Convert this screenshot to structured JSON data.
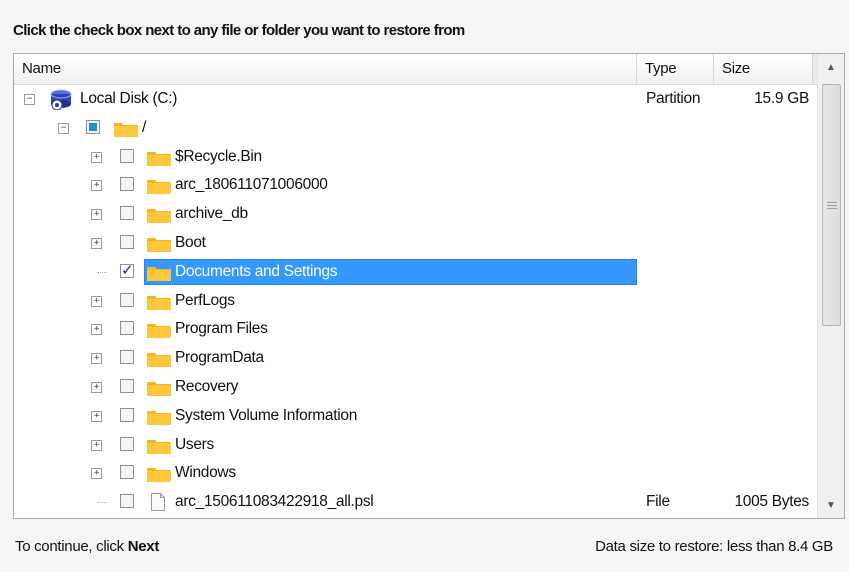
{
  "instruction": "Click the check box next to any file or folder you want to restore from",
  "columns": {
    "name": "Name",
    "type": "Type",
    "size": "Size"
  },
  "tree": {
    "disk": {
      "label": "Local Disk (C:)",
      "type": "Partition",
      "size": "15.9 GB"
    },
    "root": {
      "label": "/"
    },
    "items": [
      {
        "label": "$Recycle.Bin",
        "kind": "folder",
        "checked": false
      },
      {
        "label": "arc_180611071006000",
        "kind": "folder",
        "checked": false
      },
      {
        "label": "archive_db",
        "kind": "folder",
        "checked": false
      },
      {
        "label": "Boot",
        "kind": "folder",
        "checked": false
      },
      {
        "label": "Documents and Settings",
        "kind": "folder",
        "checked": true,
        "selected": true
      },
      {
        "label": "PerfLogs",
        "kind": "folder",
        "checked": false
      },
      {
        "label": "Program Files",
        "kind": "folder",
        "checked": false
      },
      {
        "label": "ProgramData",
        "kind": "folder",
        "checked": false
      },
      {
        "label": "Recovery",
        "kind": "folder",
        "checked": false
      },
      {
        "label": "System Volume Information",
        "kind": "folder",
        "checked": false
      },
      {
        "label": "Users",
        "kind": "folder",
        "checked": false
      },
      {
        "label": "Windows",
        "kind": "folder",
        "checked": false
      },
      {
        "label": "arc_150611083422918_all.psl",
        "kind": "file",
        "checked": false,
        "type": "File",
        "size": "1005 Bytes"
      }
    ]
  },
  "footer": {
    "continue_prefix": "To continue, click",
    "continue_action": "Next",
    "data_size": "Data size to restore: less than 8.4 GB"
  },
  "colors": {
    "selection": "#3399ff",
    "folder": "#f6b71e",
    "checkbox_partial": "#1c8fd6"
  }
}
